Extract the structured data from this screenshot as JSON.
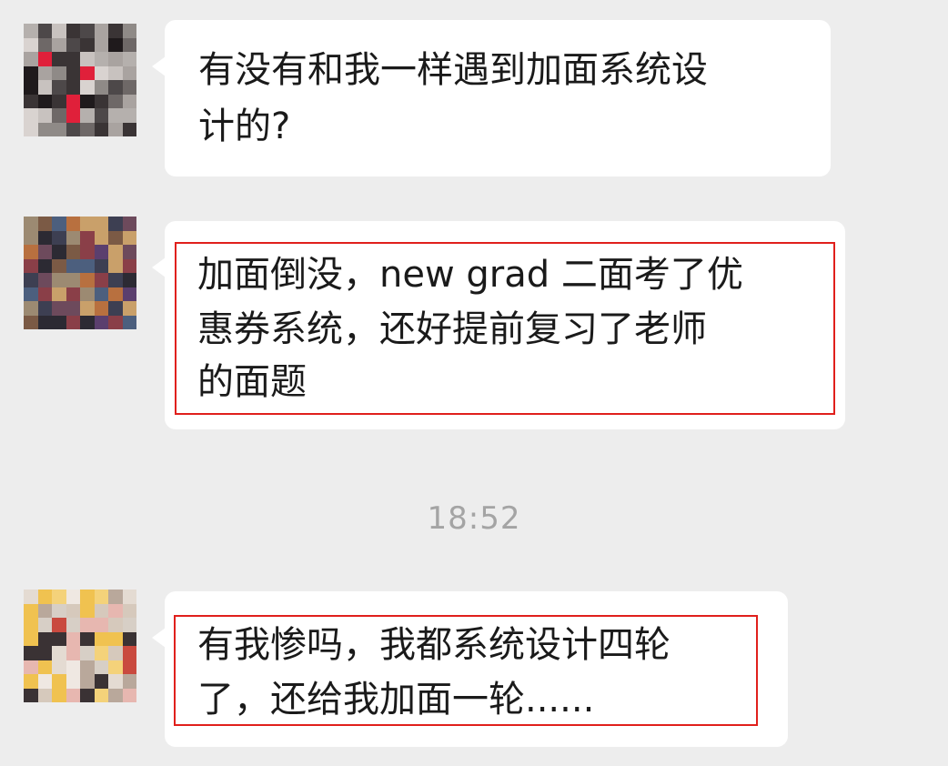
{
  "messages": [
    {
      "lines": [
        "有没有和我一样遇到加面系统设",
        "计的?"
      ],
      "highlighted": false
    },
    {
      "lines": [
        "加面倒没，new grad 二面考了优",
        "惠券系统，还好提前复习了老师",
        "的面题"
      ],
      "highlighted": true
    },
    {
      "lines": [
        "有我惨吗，我都系统设计四轮",
        "了，还给我加面一轮......"
      ],
      "highlighted": true
    }
  ],
  "timestamp": "18:52",
  "colors": {
    "background": "#ededed",
    "bubble": "#ffffff",
    "highlight_border": "#e0201c",
    "timestamp_text": "#a4a4a4"
  }
}
